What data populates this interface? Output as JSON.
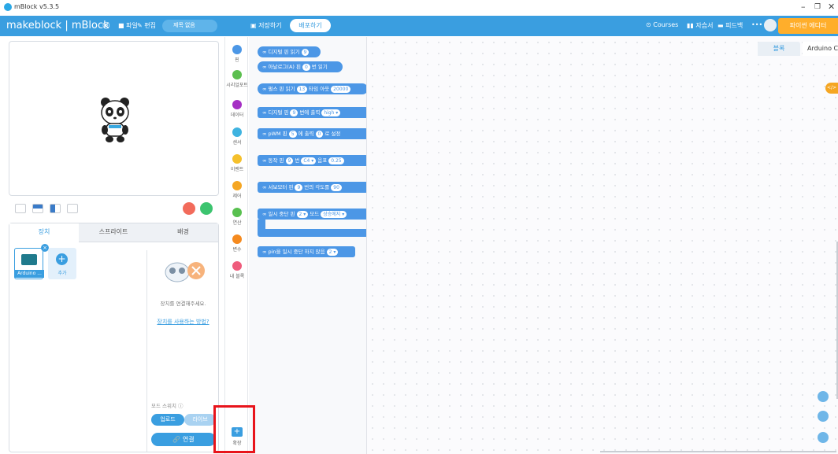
{
  "window": {
    "title": "mBlock v5.3.5"
  },
  "menubar": {
    "brand": "makeblock | mBlock",
    "file": "파일",
    "edit": "편집",
    "project_title": "제목 없음",
    "save": "저장하기",
    "publish": "배포하기",
    "courses": "Courses",
    "tutorials": "자습서",
    "feedback": "피드백",
    "more": "•••",
    "python_editor": "파이썬 에디터"
  },
  "device_tabs": [
    "장치",
    "스프라이트",
    "배경"
  ],
  "devices": [
    {
      "label": "Arduino ..."
    }
  ],
  "add_label": "추가",
  "connect_prompt": "장치를 연결해주세요.",
  "how_to_link": "장치를 사용하는 방법?",
  "mode_switch": "모드 스위치",
  "mode_upload": "업로드",
  "mode_live": "라이브",
  "connect_button": "연결",
  "categories": [
    {
      "label": "핀",
      "color": "#4c97e6"
    },
    {
      "label": "시리얼포트",
      "color": "#5cbf4f"
    },
    {
      "label": "데이터",
      "color": "#a52fc4"
    },
    {
      "label": "센서",
      "color": "#3fb3e0"
    },
    {
      "label": "이벤트",
      "color": "#f5c02c"
    },
    {
      "label": "제어",
      "color": "#f5a623"
    },
    {
      "label": "연산",
      "color": "#58c04f"
    },
    {
      "label": "변수",
      "color": "#f58a1f"
    },
    {
      "label": "내 블록",
      "color": "#ef5c7c"
    }
  ],
  "extension": "확장",
  "blocks": [
    {
      "text": "디지털 핀 읽기",
      "p1": "9"
    },
    {
      "text": "아날로그(A) 핀",
      "p1": "0",
      "t2": "번 읽기"
    },
    {
      "text": "펄스 핀 읽기",
      "p1": "13",
      "t2": "타임 아웃",
      "p2": "20000"
    },
    {
      "text": "디지털 핀",
      "p1": "9",
      "t2": "번에 출력",
      "p2": "high ▾"
    },
    {
      "text": "pWM 핀",
      "p1": "5",
      "t2": "에 출력",
      "p2": "0",
      "t3": "로 설정"
    },
    {
      "text": "동작 핀",
      "p1": "9",
      "t2": "번",
      "p2": "C4 ▾",
      "t3": "음표",
      "p3": "0.25"
    },
    {
      "text": "서보모터 핀",
      "p1": "9",
      "t2": "번의 각도를",
      "p2": "90"
    },
    {
      "text": "일시 중단 핀",
      "p1": "2 ▾",
      "t2": "모드",
      "p2": "상승에지 ▾"
    },
    {
      "text": "pin을 일시 중단 하지 않음",
      "p1": "2 ▾"
    }
  ],
  "workspace_tabs": {
    "blocks": "블록",
    "arduino": "Arduino C"
  },
  "code_badge": "</>"
}
